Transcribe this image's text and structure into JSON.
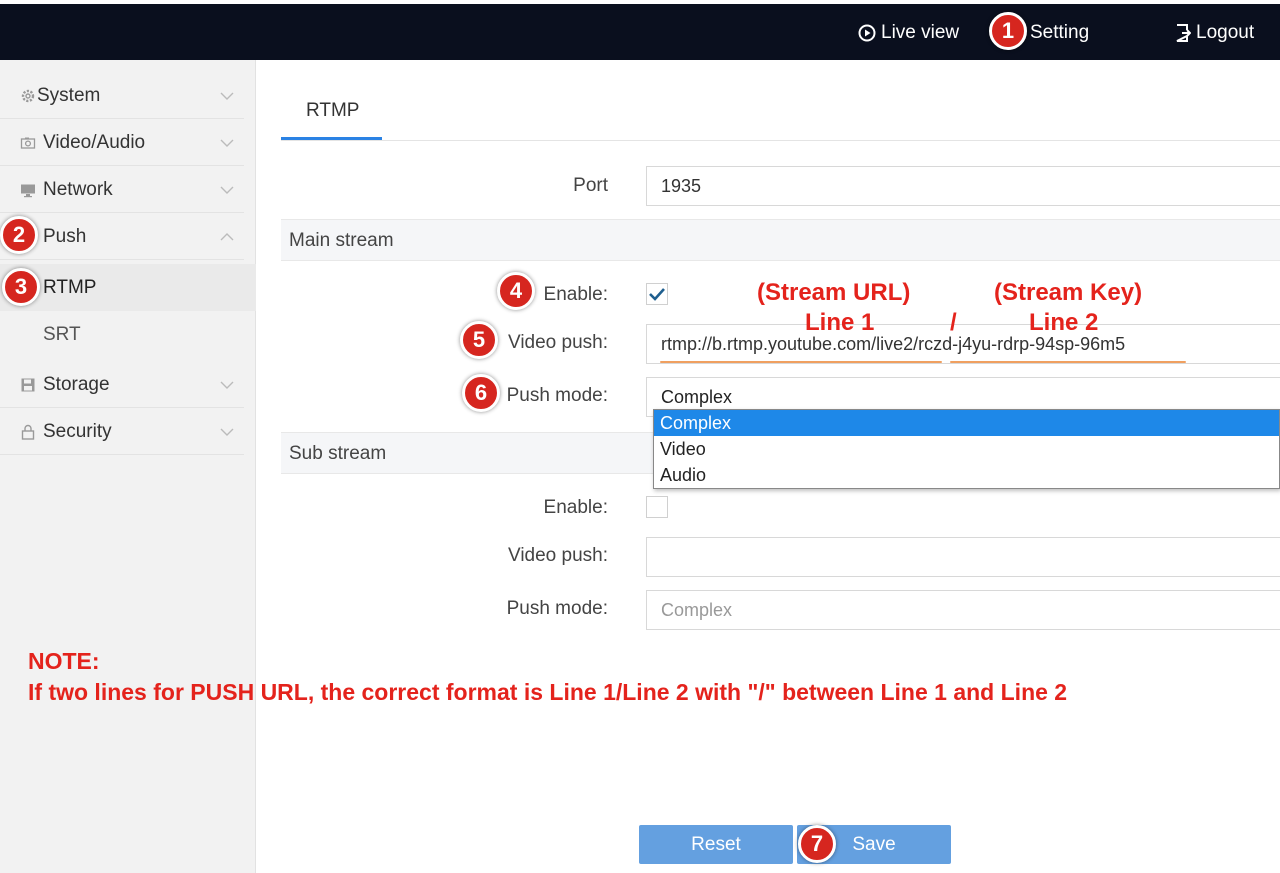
{
  "topbar": {
    "live_view": "Live view",
    "setting": "Setting",
    "logout": "Logout"
  },
  "sidebar": {
    "items": [
      {
        "label": "System",
        "icon": "gear-icon"
      },
      {
        "label": "Video/Audio",
        "icon": "camera-icon"
      },
      {
        "label": "Network",
        "icon": "monitor-icon"
      },
      {
        "label": "Push",
        "icon": "push-icon"
      },
      {
        "label": "Storage",
        "icon": "floppy-icon"
      },
      {
        "label": "Security",
        "icon": "lock-icon"
      }
    ],
    "sub_items": [
      {
        "label": "RTMP",
        "active": true
      },
      {
        "label": "SRT",
        "active": false
      }
    ]
  },
  "main": {
    "tab": "RTMP",
    "port_label": "Port",
    "port_value": "1935",
    "main_stream": {
      "title": "Main stream",
      "enable_label": "Enable:",
      "enabled": true,
      "video_push_label": "Video push:",
      "video_push_value": "rtmp://b.rtmp.youtube.com/live2/rczd-j4yu-rdrp-94sp-96m5",
      "push_mode_label": "Push mode:",
      "push_mode_value": "Complex",
      "push_mode_options": [
        "Complex",
        "Video",
        "Audio"
      ]
    },
    "sub_stream": {
      "title": "Sub stream",
      "enable_label": "Enable:",
      "enabled": false,
      "video_push_label": "Video push:",
      "video_push_value": "",
      "push_mode_label": "Push mode:",
      "push_mode_value": "Complex"
    }
  },
  "annotations": {
    "stream_url": "(Stream URL)",
    "line1": "Line 1",
    "slash": "/",
    "stream_key": "(Stream Key)",
    "line2": "Line 2",
    "note_title": "NOTE:",
    "note_text": "If two lines for PUSH URL, the correct format is Line 1/Line 2 with \"/\" between Line 1 and Line 2",
    "markers": [
      "1",
      "2",
      "3",
      "4",
      "5",
      "6",
      "7"
    ]
  },
  "buttons": {
    "reset": "Reset",
    "save": "Save"
  },
  "colors": {
    "topbar": "#0a0f1e",
    "accent": "#2a82e4",
    "button": "#64a0e0",
    "marker": "#d6261f",
    "annotation": "#e4231c",
    "dropdown_selected": "#1e88e8"
  }
}
